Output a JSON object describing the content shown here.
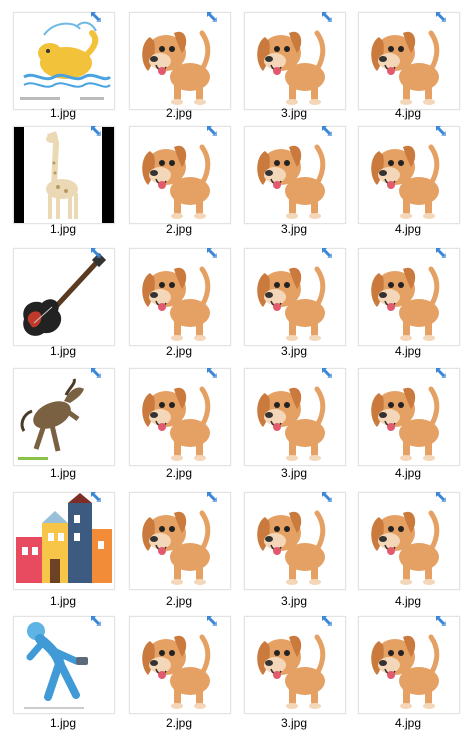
{
  "window": {
    "view": "large-icons"
  },
  "files": [
    {
      "row": 0,
      "col": 0,
      "name": "1.jpg",
      "icon": "elephant-bath-icon"
    },
    {
      "row": 0,
      "col": 1,
      "name": "2.jpg",
      "icon": "cartoon-dog-icon"
    },
    {
      "row": 0,
      "col": 2,
      "name": "3.jpg",
      "icon": "cartoon-dog-icon"
    },
    {
      "row": 0,
      "col": 3,
      "name": "4.jpg",
      "icon": "cartoon-dog-icon"
    },
    {
      "row": 1,
      "col": 0,
      "name": "1.jpg",
      "icon": "giraffe-icon"
    },
    {
      "row": 1,
      "col": 1,
      "name": "2.jpg",
      "icon": "cartoon-dog-icon"
    },
    {
      "row": 1,
      "col": 2,
      "name": "3.jpg",
      "icon": "cartoon-dog-icon"
    },
    {
      "row": 1,
      "col": 3,
      "name": "4.jpg",
      "icon": "cartoon-dog-icon"
    },
    {
      "row": 2,
      "col": 0,
      "name": "1.jpg",
      "icon": "electric-guitar-icon"
    },
    {
      "row": 2,
      "col": 1,
      "name": "2.jpg",
      "icon": "cartoon-dog-icon"
    },
    {
      "row": 2,
      "col": 2,
      "name": "3.jpg",
      "icon": "cartoon-dog-icon"
    },
    {
      "row": 2,
      "col": 3,
      "name": "4.jpg",
      "icon": "cartoon-dog-icon"
    },
    {
      "row": 3,
      "col": 0,
      "name": "1.jpg",
      "icon": "rearing-horse-icon"
    },
    {
      "row": 3,
      "col": 1,
      "name": "2.jpg",
      "icon": "cartoon-dog-icon"
    },
    {
      "row": 3,
      "col": 2,
      "name": "3.jpg",
      "icon": "cartoon-dog-icon"
    },
    {
      "row": 3,
      "col": 3,
      "name": "4.jpg",
      "icon": "cartoon-dog-icon"
    },
    {
      "row": 4,
      "col": 0,
      "name": "1.jpg",
      "icon": "colorful-houses-icon"
    },
    {
      "row": 4,
      "col": 1,
      "name": "2.jpg",
      "icon": "cartoon-dog-icon"
    },
    {
      "row": 4,
      "col": 2,
      "name": "3.jpg",
      "icon": "cartoon-dog-icon"
    },
    {
      "row": 4,
      "col": 3,
      "name": "4.jpg",
      "icon": "cartoon-dog-icon"
    },
    {
      "row": 5,
      "col": 0,
      "name": "1.jpg",
      "icon": "blue-figure-icon"
    },
    {
      "row": 5,
      "col": 1,
      "name": "2.jpg",
      "icon": "cartoon-dog-icon"
    },
    {
      "row": 5,
      "col": 2,
      "name": "3.jpg",
      "icon": "cartoon-dog-icon"
    },
    {
      "row": 5,
      "col": 3,
      "name": "4.jpg",
      "icon": "cartoon-dog-icon"
    }
  ],
  "colors": {
    "shortcut_arrow": "#3a86d8",
    "dog_fur": "#e5a063",
    "dog_ear": "#c97a3c",
    "label_text": "#000000"
  }
}
